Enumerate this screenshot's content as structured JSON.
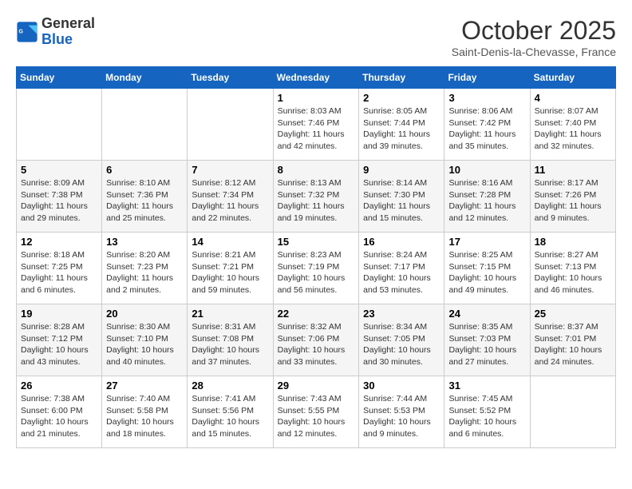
{
  "header": {
    "logo_general": "General",
    "logo_blue": "Blue",
    "month": "October 2025",
    "location": "Saint-Denis-la-Chevasse, France"
  },
  "days_of_week": [
    "Sunday",
    "Monday",
    "Tuesday",
    "Wednesday",
    "Thursday",
    "Friday",
    "Saturday"
  ],
  "weeks": [
    [
      {
        "num": "",
        "info": ""
      },
      {
        "num": "",
        "info": ""
      },
      {
        "num": "",
        "info": ""
      },
      {
        "num": "1",
        "info": "Sunrise: 8:03 AM\nSunset: 7:46 PM\nDaylight: 11 hours\nand 42 minutes."
      },
      {
        "num": "2",
        "info": "Sunrise: 8:05 AM\nSunset: 7:44 PM\nDaylight: 11 hours\nand 39 minutes."
      },
      {
        "num": "3",
        "info": "Sunrise: 8:06 AM\nSunset: 7:42 PM\nDaylight: 11 hours\nand 35 minutes."
      },
      {
        "num": "4",
        "info": "Sunrise: 8:07 AM\nSunset: 7:40 PM\nDaylight: 11 hours\nand 32 minutes."
      }
    ],
    [
      {
        "num": "5",
        "info": "Sunrise: 8:09 AM\nSunset: 7:38 PM\nDaylight: 11 hours\nand 29 minutes."
      },
      {
        "num": "6",
        "info": "Sunrise: 8:10 AM\nSunset: 7:36 PM\nDaylight: 11 hours\nand 25 minutes."
      },
      {
        "num": "7",
        "info": "Sunrise: 8:12 AM\nSunset: 7:34 PM\nDaylight: 11 hours\nand 22 minutes."
      },
      {
        "num": "8",
        "info": "Sunrise: 8:13 AM\nSunset: 7:32 PM\nDaylight: 11 hours\nand 19 minutes."
      },
      {
        "num": "9",
        "info": "Sunrise: 8:14 AM\nSunset: 7:30 PM\nDaylight: 11 hours\nand 15 minutes."
      },
      {
        "num": "10",
        "info": "Sunrise: 8:16 AM\nSunset: 7:28 PM\nDaylight: 11 hours\nand 12 minutes."
      },
      {
        "num": "11",
        "info": "Sunrise: 8:17 AM\nSunset: 7:26 PM\nDaylight: 11 hours\nand 9 minutes."
      }
    ],
    [
      {
        "num": "12",
        "info": "Sunrise: 8:18 AM\nSunset: 7:25 PM\nDaylight: 11 hours\nand 6 minutes."
      },
      {
        "num": "13",
        "info": "Sunrise: 8:20 AM\nSunset: 7:23 PM\nDaylight: 11 hours\nand 2 minutes."
      },
      {
        "num": "14",
        "info": "Sunrise: 8:21 AM\nSunset: 7:21 PM\nDaylight: 10 hours\nand 59 minutes."
      },
      {
        "num": "15",
        "info": "Sunrise: 8:23 AM\nSunset: 7:19 PM\nDaylight: 10 hours\nand 56 minutes."
      },
      {
        "num": "16",
        "info": "Sunrise: 8:24 AM\nSunset: 7:17 PM\nDaylight: 10 hours\nand 53 minutes."
      },
      {
        "num": "17",
        "info": "Sunrise: 8:25 AM\nSunset: 7:15 PM\nDaylight: 10 hours\nand 49 minutes."
      },
      {
        "num": "18",
        "info": "Sunrise: 8:27 AM\nSunset: 7:13 PM\nDaylight: 10 hours\nand 46 minutes."
      }
    ],
    [
      {
        "num": "19",
        "info": "Sunrise: 8:28 AM\nSunset: 7:12 PM\nDaylight: 10 hours\nand 43 minutes."
      },
      {
        "num": "20",
        "info": "Sunrise: 8:30 AM\nSunset: 7:10 PM\nDaylight: 10 hours\nand 40 minutes."
      },
      {
        "num": "21",
        "info": "Sunrise: 8:31 AM\nSunset: 7:08 PM\nDaylight: 10 hours\nand 37 minutes."
      },
      {
        "num": "22",
        "info": "Sunrise: 8:32 AM\nSunset: 7:06 PM\nDaylight: 10 hours\nand 33 minutes."
      },
      {
        "num": "23",
        "info": "Sunrise: 8:34 AM\nSunset: 7:05 PM\nDaylight: 10 hours\nand 30 minutes."
      },
      {
        "num": "24",
        "info": "Sunrise: 8:35 AM\nSunset: 7:03 PM\nDaylight: 10 hours\nand 27 minutes."
      },
      {
        "num": "25",
        "info": "Sunrise: 8:37 AM\nSunset: 7:01 PM\nDaylight: 10 hours\nand 24 minutes."
      }
    ],
    [
      {
        "num": "26",
        "info": "Sunrise: 7:38 AM\nSunset: 6:00 PM\nDaylight: 10 hours\nand 21 minutes."
      },
      {
        "num": "27",
        "info": "Sunrise: 7:40 AM\nSunset: 5:58 PM\nDaylight: 10 hours\nand 18 minutes."
      },
      {
        "num": "28",
        "info": "Sunrise: 7:41 AM\nSunset: 5:56 PM\nDaylight: 10 hours\nand 15 minutes."
      },
      {
        "num": "29",
        "info": "Sunrise: 7:43 AM\nSunset: 5:55 PM\nDaylight: 10 hours\nand 12 minutes."
      },
      {
        "num": "30",
        "info": "Sunrise: 7:44 AM\nSunset: 5:53 PM\nDaylight: 10 hours\nand 9 minutes."
      },
      {
        "num": "31",
        "info": "Sunrise: 7:45 AM\nSunset: 5:52 PM\nDaylight: 10 hours\nand 6 minutes."
      },
      {
        "num": "",
        "info": ""
      }
    ]
  ]
}
